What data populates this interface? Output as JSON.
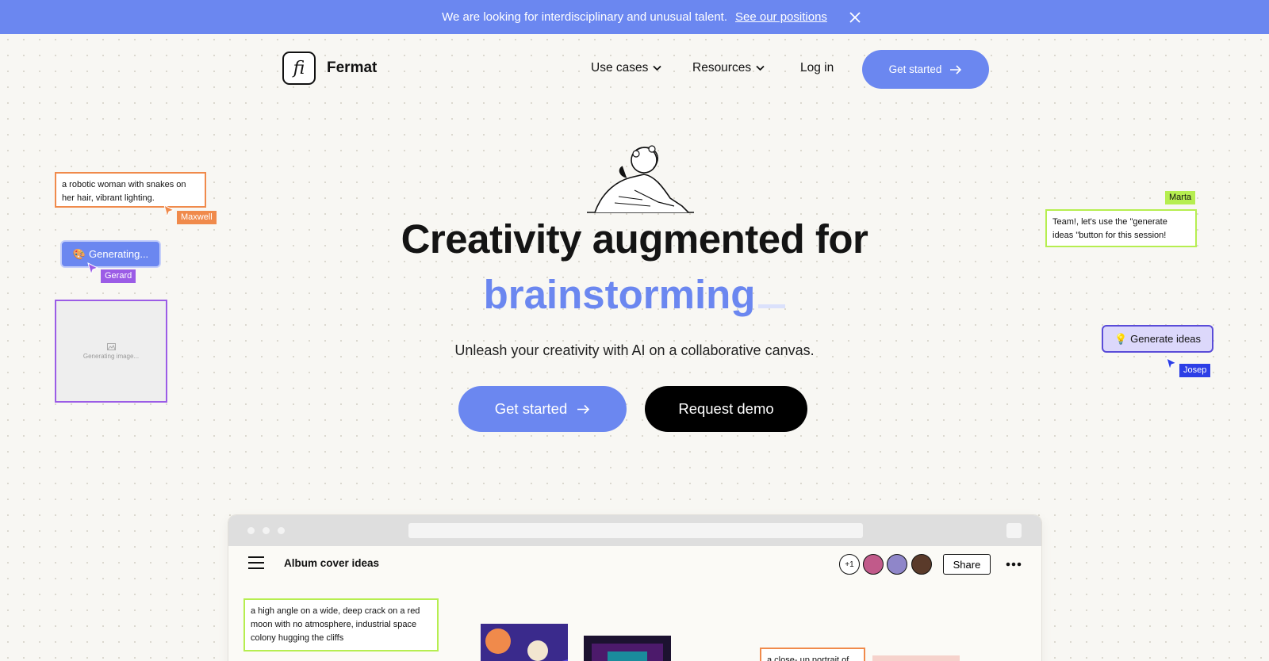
{
  "banner": {
    "message": "We are looking for interdisciplinary and unusual talent.",
    "link": "See our positions"
  },
  "brand": {
    "logo_glyph": "fi",
    "name": "Fermat"
  },
  "nav": {
    "use_cases": "Use cases",
    "resources": "Resources",
    "login": "Log in",
    "cta": "Get started"
  },
  "hero": {
    "headline": "Creativity augmented for",
    "accent": "brainstorming",
    "subhead": "Unleash your creativity with AI on a collaborative canvas.",
    "primary_cta": "Get started",
    "secondary_cta": "Request demo"
  },
  "canvas_left": {
    "prompt_note": "a robotic woman with snakes on her hair, vibrant lighting.",
    "maxwell_tag": "Maxwell",
    "generating_pill": "Generating...",
    "gerard_tag": "Gerard",
    "image_placeholder": "Generating image..."
  },
  "canvas_right": {
    "marta_tag": "Marta",
    "team_note": "Team!, let's use the \"generate ideas \"button for this session!",
    "generate_pill": "Generate ideas",
    "josep_tag": "Josep"
  },
  "app": {
    "doc_title": "Album cover ideas",
    "collaborators_extra": "+1",
    "share": "Share",
    "note_crack": "a high angle on a wide, deep crack on a red moon with no atmosphere, industrial space colony hugging the cliffs",
    "note_portrait": "a close- up portrait of"
  },
  "colors": {
    "accent": "#6b87f0",
    "orange": "#f08a4b",
    "purple": "#9b5ce6",
    "lime": "#b6ee50",
    "blue": "#2c3ee6"
  }
}
